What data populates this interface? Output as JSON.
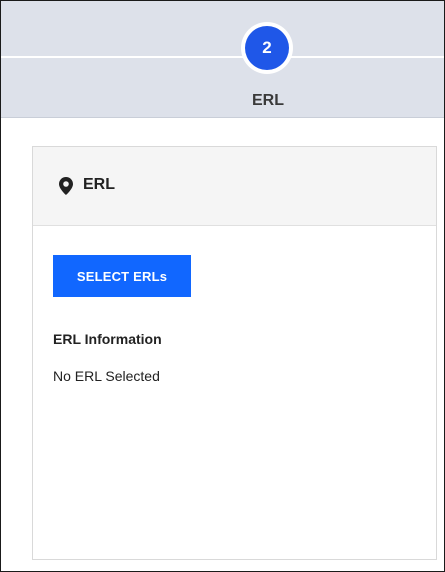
{
  "stepper": {
    "step_number": "2",
    "step_label": "ERL"
  },
  "card": {
    "icon": "map-marker-icon",
    "title": "ERL",
    "select_button_label": "SELECT ERLs",
    "info_heading": "ERL Information",
    "info_value": "No ERL Selected"
  },
  "colors": {
    "accent": "#1167ff",
    "step_circle": "#1f57e8",
    "stepper_bg": "#dde1ea"
  }
}
